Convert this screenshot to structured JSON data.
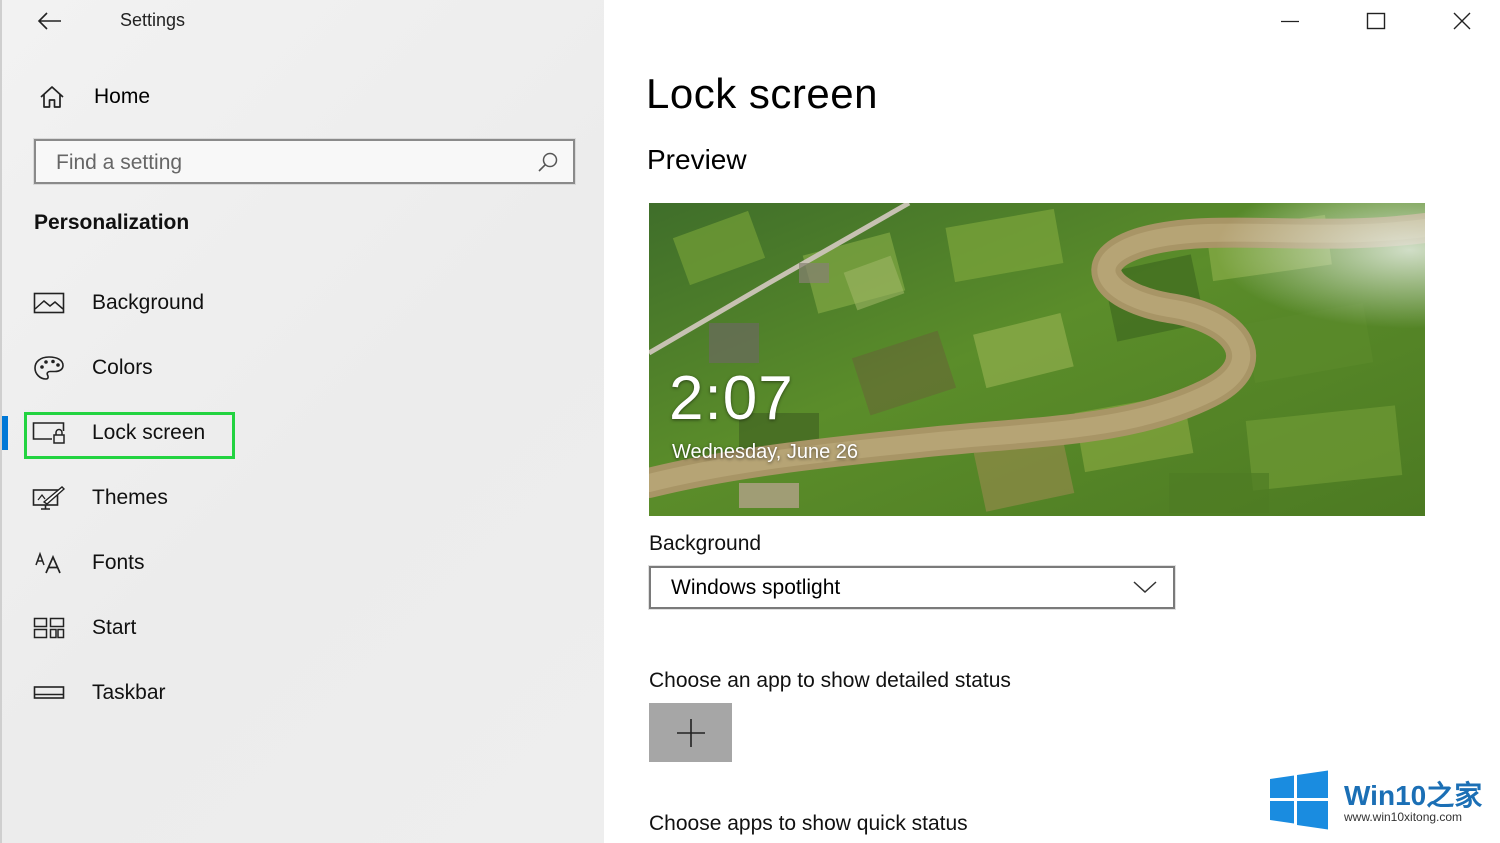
{
  "window": {
    "title": "Settings",
    "controls": {
      "minimize": "minimize",
      "maximize": "maximize",
      "close": "close"
    }
  },
  "sidebar": {
    "home_label": "Home",
    "search": {
      "placeholder": "Find a setting",
      "value": ""
    },
    "section_heading": "Personalization",
    "items": [
      {
        "label": "Background",
        "icon": "picture-icon",
        "selected": false
      },
      {
        "label": "Colors",
        "icon": "palette-icon",
        "selected": false
      },
      {
        "label": "Lock screen",
        "icon": "lock-screen-icon",
        "selected": true
      },
      {
        "label": "Themes",
        "icon": "themes-icon",
        "selected": false
      },
      {
        "label": "Fonts",
        "icon": "fonts-icon",
        "selected": false
      },
      {
        "label": "Start",
        "icon": "start-icon",
        "selected": false
      },
      {
        "label": "Taskbar",
        "icon": "taskbar-icon",
        "selected": false
      }
    ],
    "accent_color": "#0078d7",
    "highlight_color": "#22d340"
  },
  "main": {
    "title": "Lock screen",
    "preview_heading": "Preview",
    "preview": {
      "time": "2:07",
      "date": "Wednesday, June 26"
    },
    "background_label": "Background",
    "background_value": "Windows spotlight",
    "detailed_status_label": "Choose an app to show detailed status",
    "quick_status_label": "Choose apps to show quick status"
  },
  "watermark": {
    "brand": "Win10之家",
    "url": "www.win10xitong.com",
    "color": "#1b6fb5"
  }
}
